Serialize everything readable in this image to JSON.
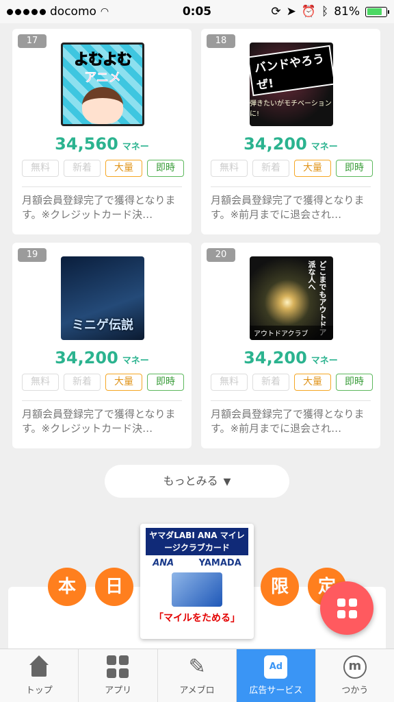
{
  "status_bar": {
    "carrier": "docomo",
    "time": "0:05",
    "battery": "81%",
    "battery_level": 0.81
  },
  "cards": [
    {
      "rank": "17",
      "thumb_title": "よむよむ",
      "thumb_sub": "アニメ",
      "price": "34,560",
      "unit": "マネー",
      "tags": [
        "無料",
        "新着",
        "大量",
        "即時"
      ],
      "desc": "月額会員登録完了で獲得となります。※クレジットカード決…"
    },
    {
      "rank": "18",
      "thumb_title": "バンドやろうぜ!",
      "thumb_sub": "弾きたいがモチベーションに!",
      "price": "34,200",
      "unit": "マネー",
      "tags": [
        "無料",
        "新着",
        "大量",
        "即時"
      ],
      "desc": "月額会員登録完了で獲得となります。※前月までに退会され…"
    },
    {
      "rank": "19",
      "thumb_title": "ミニゲ伝説",
      "price": "34,200",
      "unit": "マネー",
      "tags": [
        "無料",
        "新着",
        "大量",
        "即時"
      ],
      "desc": "月額会員登録完了で獲得となります。※クレジットカード決…"
    },
    {
      "rank": "20",
      "thumb_title": "どこまでもアウトドア派な人へ",
      "thumb_sub": "アウトドアクラブ",
      "price": "34,200",
      "unit": "マネー",
      "tags": [
        "無料",
        "新着",
        "大量",
        "即時"
      ],
      "desc": "月額会員登録完了で獲得となります。※前月までに退会され…"
    }
  ],
  "more_label": "もっとみる",
  "campaign": {
    "chars": [
      "本",
      "日",
      "限",
      "定"
    ],
    "promo_head": "ヤマダLABI ANA マイレージクラブカード",
    "logo_ana": "ANA",
    "logo_yamada": "YAMADA",
    "cta": "「マイルをためる」"
  },
  "tab_bar": {
    "tabs": [
      {
        "label": "トップ",
        "icon": "home-icon"
      },
      {
        "label": "アプリ",
        "icon": "apps-icon"
      },
      {
        "label": "アメブロ",
        "icon": "pen-icon"
      },
      {
        "label": "広告サービス",
        "icon": "ad-icon",
        "active": true
      },
      {
        "label": "つかう",
        "icon": "coin-icon"
      }
    ]
  },
  "colors": {
    "accent": "#2bb38f",
    "tab_active": "#3a95f5",
    "fab": "#ff5a5f",
    "campaign": "#ff7f1e"
  }
}
